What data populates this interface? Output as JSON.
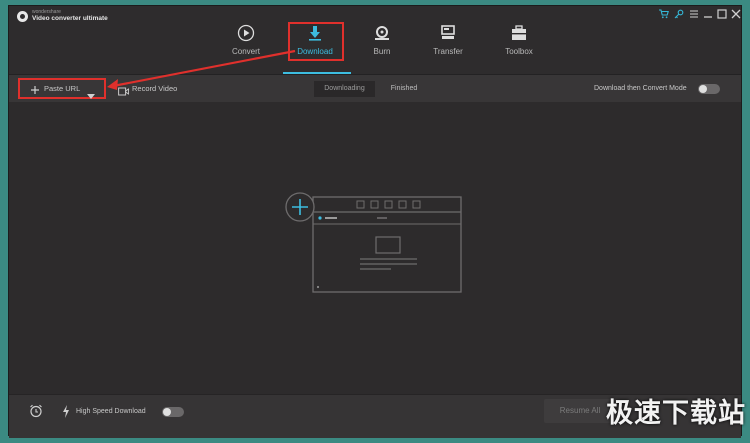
{
  "app": {
    "brand_small": "wondershare",
    "brand_name": "Video converter ultimate"
  },
  "window_controls": [
    "cart-icon",
    "key-icon",
    "menu-icon",
    "minimize-icon",
    "maximize-icon",
    "close-icon"
  ],
  "tabs": [
    {
      "label": "Convert",
      "icon": "play-circle-icon",
      "active": false
    },
    {
      "label": "Download",
      "icon": "download-icon",
      "active": true
    },
    {
      "label": "Burn",
      "icon": "disc-icon",
      "active": false
    },
    {
      "label": "Transfer",
      "icon": "transfer-icon",
      "active": false
    },
    {
      "label": "Toolbox",
      "icon": "toolbox-icon",
      "active": false
    }
  ],
  "toolbar": {
    "paste_url": "Paste URL",
    "record_video": "Record Video",
    "segments": [
      {
        "label": "Downloading",
        "selected": true
      },
      {
        "label": "Finished",
        "selected": false
      }
    ],
    "mode_label": "Download then Convert Mode",
    "mode_on": false
  },
  "footer": {
    "high_speed_label": "High Speed Download",
    "high_speed_on": false,
    "action_label": "Resume All"
  },
  "watermark": "极速下载站",
  "colors": {
    "accent": "#3dbde0",
    "highlight": "#e0302c",
    "background": "#2d2b2c",
    "desktop": "#3b8a82"
  }
}
